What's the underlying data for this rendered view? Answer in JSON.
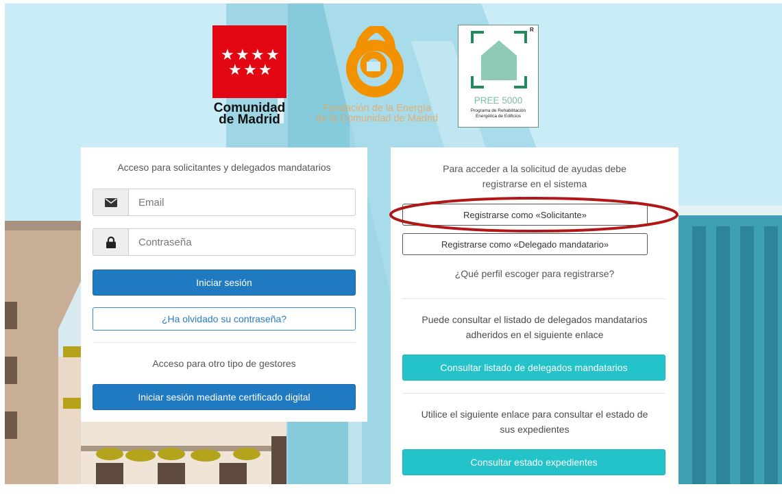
{
  "colors": {
    "sky": "#cdeef7",
    "primary_blue": "#1f7ac1",
    "teal": "#24c3c9",
    "brand_red": "#e30613",
    "brand_orange": "#f39200",
    "pree_green": "#7cbca8",
    "annotation_red": "#b01818"
  },
  "logos": {
    "comunidad_madrid": {
      "icon": "madrid-stars-icon",
      "line1": "Comunidad",
      "line2": "de Madrid"
    },
    "fenercom": {
      "icon": "fenercom-swirl-icon",
      "line1": "Fundación de la Energía",
      "line2": "de la Comunidad de Madrid"
    },
    "pree": {
      "icon": "house-icon",
      "registered": "R",
      "title": "PREE 5000",
      "subtitle_line1": "Programa de Rehabilitación",
      "subtitle_line2": "Energética de Edificios"
    }
  },
  "login": {
    "heading": "Acceso para solicitantes y delegados mandatarios",
    "email": {
      "icon": "envelope-icon",
      "placeholder": "Email",
      "value": ""
    },
    "password": {
      "icon": "lock-icon",
      "placeholder": "Contraseña",
      "value": ""
    },
    "login_button": "Iniciar sesión",
    "forgot_button": "¿Ha olvidado su contraseña?",
    "other_heading": "Acceso para otro tipo de gestores",
    "certificate_button": "Iniciar sesión mediante certificado digital"
  },
  "register": {
    "intro_line1": "Para acceder a la solicitud de ayudas debe",
    "intro_line2": "registrarse en el sistema",
    "solicitante_button": "Registrarse como «Solicitante»",
    "delegado_button": "Registrarse como «Delegado mandatario»",
    "profile_link": "¿Qué perfil escoger para registrarse?",
    "delegados_text_line1": "Puede consultar el listado de delegados mandatarios",
    "delegados_text_line2": "adheridos en el siguiente enlace",
    "delegados_button": "Consultar listado de delegados mandatarios",
    "expedientes_text_line1": "Utilice el siguiente enlace para consultar el estado de",
    "expedientes_text_line2": "sus expedientes",
    "expedientes_button": "Consultar estado expedientes"
  }
}
